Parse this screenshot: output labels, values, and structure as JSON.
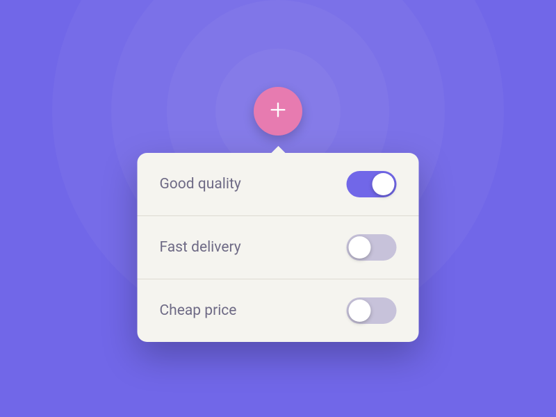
{
  "colors": {
    "background": "#7167e8",
    "fab": "#e77bb0",
    "popover": "#f5f4ef",
    "toggle_on": "#7167e8",
    "toggle_off": "#c7c2da",
    "text": "#6e6a85"
  },
  "fab": {
    "icon": "plus"
  },
  "options": [
    {
      "label": "Good quality",
      "enabled": true
    },
    {
      "label": "Fast delivery",
      "enabled": false
    },
    {
      "label": "Cheap price",
      "enabled": false
    }
  ]
}
